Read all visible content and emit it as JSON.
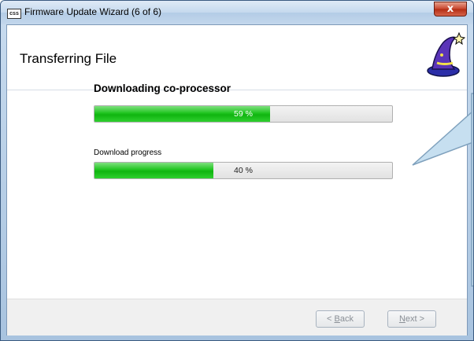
{
  "window": {
    "title": "Firmware Update Wizard (6 of 6)",
    "app_icon_text": "css",
    "close_symbol": "x"
  },
  "header": {
    "page_title": "Transferring File",
    "logo_icon": "wizard-hat-icon"
  },
  "main": {
    "heading": "Downloading co-processor",
    "primary_progress": {
      "value": 59,
      "label": "59 %"
    },
    "secondary_progress_label": "Download progress",
    "secondary_progress": {
      "value": 40,
      "label": "40 %"
    }
  },
  "footer": {
    "back_label": "< Back",
    "next_label": "Next >"
  },
  "colors": {
    "progress_green": "#13b813",
    "callout_fill": "#c6dff0",
    "callout_border": "#7fa1bd",
    "title_bar": "#c5d9ee"
  }
}
